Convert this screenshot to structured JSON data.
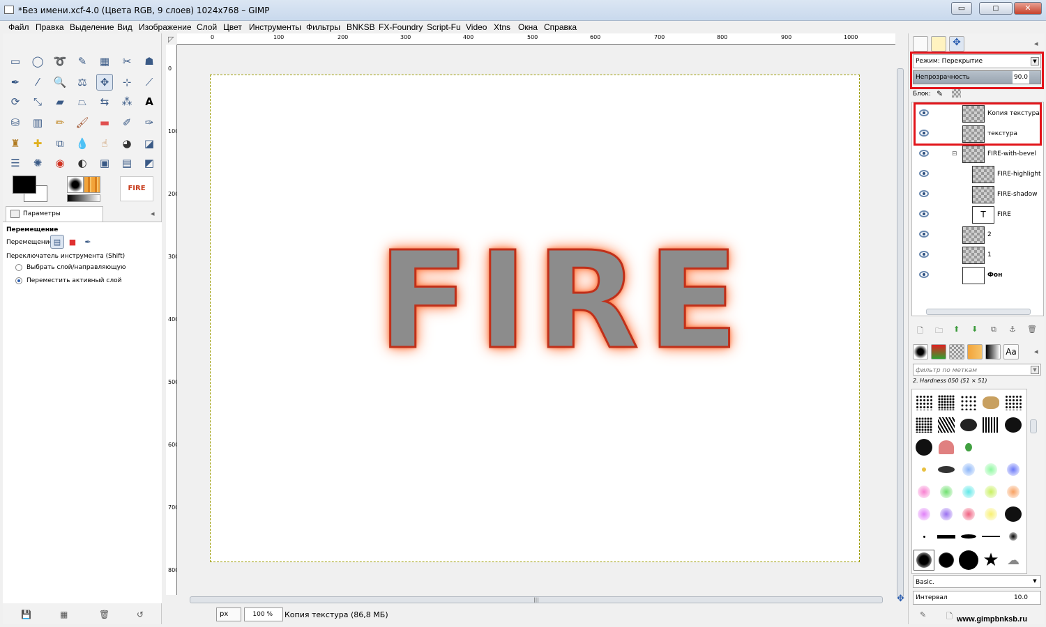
{
  "window": {
    "title": "*Без имени.xcf-4.0 (Цвета RGB, 9 слоев) 1024x768 – GIMP",
    "min": "▭",
    "max": "◻",
    "close": "✕"
  },
  "menu": [
    "Файл",
    "Правка",
    "Выделение",
    "Вид",
    "Изображение",
    "Слой",
    "Цвет",
    "Инструменты",
    "Фильтры",
    "BNKSB",
    "FX-Foundry",
    "Script-Fu",
    "Video",
    "Xtns",
    "Окна",
    "Справка"
  ],
  "toolbox": {
    "image_preview_text": "FIRE",
    "tab_title": "Параметры инструментов",
    "options_title": "Перемещение",
    "move_label": "Перемещение:",
    "switch_label": "Переключатель инструмента  (Shift)",
    "radio1": "Выбрать слой/направляющую",
    "radio2": "Переместить активный слой"
  },
  "ruler_labels": [
    "0",
    "100",
    "200",
    "300",
    "400",
    "500",
    "600",
    "700",
    "800",
    "900",
    "1000"
  ],
  "vruler_labels": [
    "0",
    "100",
    "200",
    "300",
    "400",
    "500",
    "600",
    "700",
    "800"
  ],
  "canvas": {
    "text": "FIRE"
  },
  "status": {
    "unit": "px",
    "zoom": "100 %",
    "text": "Копия текстура (86,8 МБ)"
  },
  "layers_panel": {
    "mode_label": "Режим: Перекрытие",
    "opacity_label": "Непрозрачность",
    "opacity_value": "90.0",
    "lock_label": "Блок:",
    "layers": [
      {
        "name": "Копия текстура"
      },
      {
        "name": "текстура"
      },
      {
        "name": "FIRE-with-bevel"
      },
      {
        "name": "FIRE-highlight"
      },
      {
        "name": "FIRE-shadow"
      },
      {
        "name": "FIRE"
      },
      {
        "name": "2"
      },
      {
        "name": "1"
      },
      {
        "name": "Фон"
      }
    ]
  },
  "brushes_panel": {
    "filter_placeholder": "фильтр по меткам",
    "brush_name": "2. Hardness 050 (51 × 51)",
    "preset": "Basic.",
    "spacing_label": "Интервал",
    "spacing_value": "10.0"
  },
  "watermark": "www.gimpbnksb.ru",
  "colors": {
    "accent_red": "#e2141a",
    "fire_glow": "#ff5a20"
  }
}
